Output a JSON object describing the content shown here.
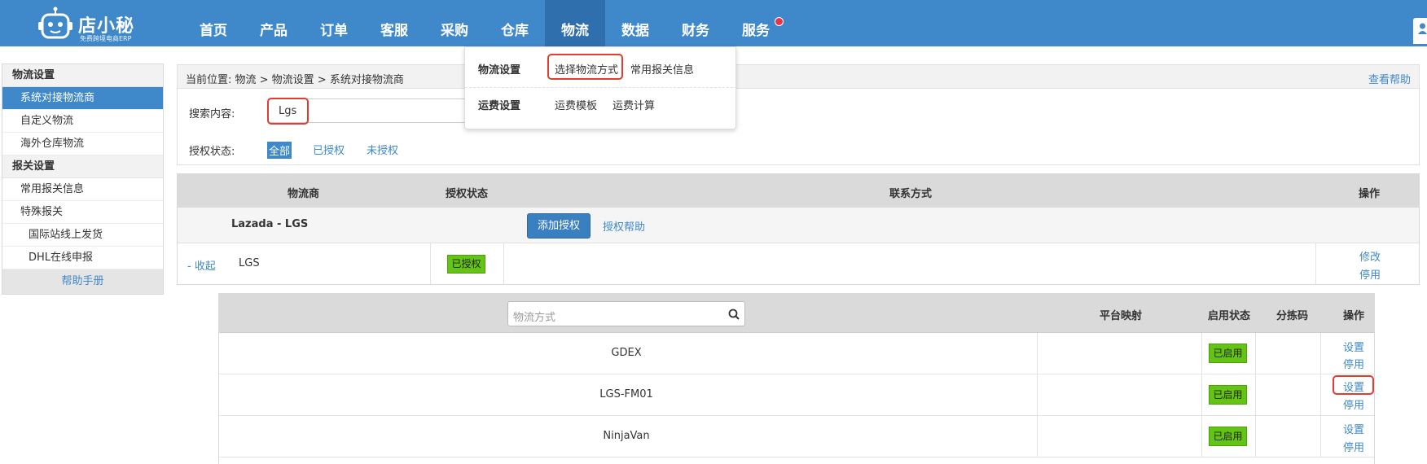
{
  "brand": {
    "name": "店小秘",
    "tagline": "免费跨境电商ERP"
  },
  "nav": [
    "首页",
    "产品",
    "订单",
    "客服",
    "采购",
    "仓库",
    "物流",
    "数据",
    "财务",
    "服务"
  ],
  "dropdown": {
    "row1": {
      "heading": "物流设置",
      "links": [
        "选择物流方式",
        "常用报关信息"
      ]
    },
    "row2": {
      "heading": "运费设置",
      "links": [
        "运费模板",
        "运费计算"
      ]
    }
  },
  "sidebar": {
    "group1": "物流设置",
    "items1": [
      "系统对接物流商",
      "自定义物流",
      "海外仓库物流"
    ],
    "group2": "报关设置",
    "items2": [
      "常用报关信息",
      "特殊报关"
    ],
    "subitems": [
      "国际站线上发货",
      "DHL在线申报"
    ],
    "help": "帮助手册"
  },
  "breadcrumb": {
    "text": "当前位置:  物流 >  物流设置 > 系统对接物流商",
    "help": "查看帮助"
  },
  "filter": {
    "search_label": "搜索内容:",
    "search_value": "Lgs",
    "auth_label": "授权状态:",
    "tabs": [
      "全部",
      "已授权",
      "未授权"
    ]
  },
  "provider_table": {
    "headers": [
      "物流商",
      "授权状态",
      "联系方式",
      "操作"
    ],
    "group": {
      "name": "Lazada - LGS",
      "add_button": "添加授权",
      "help_link": "授权帮助"
    },
    "row": {
      "collapse": "- 收起",
      "name": "LGS",
      "status": "已授权",
      "ops": [
        "修改",
        "停用"
      ]
    }
  },
  "method_table": {
    "search_placeholder": "物流方式",
    "headers": [
      "平台映射",
      "启用状态",
      "分拣码",
      "操作"
    ],
    "rows": [
      {
        "name": "GDEX",
        "status": "已启用",
        "ops": [
          "设置",
          "停用"
        ]
      },
      {
        "name": "LGS-FM01",
        "status": "已启用",
        "ops": [
          "设置",
          "停用"
        ]
      },
      {
        "name": "NinjaVan",
        "status": "已启用",
        "ops": [
          "设置",
          "停用"
        ]
      }
    ]
  },
  "colors": {
    "primary": "#3f88c9",
    "active_nav": "#2f6fae",
    "badge_green": "#63c414",
    "highlight_red": "#e03c31"
  }
}
